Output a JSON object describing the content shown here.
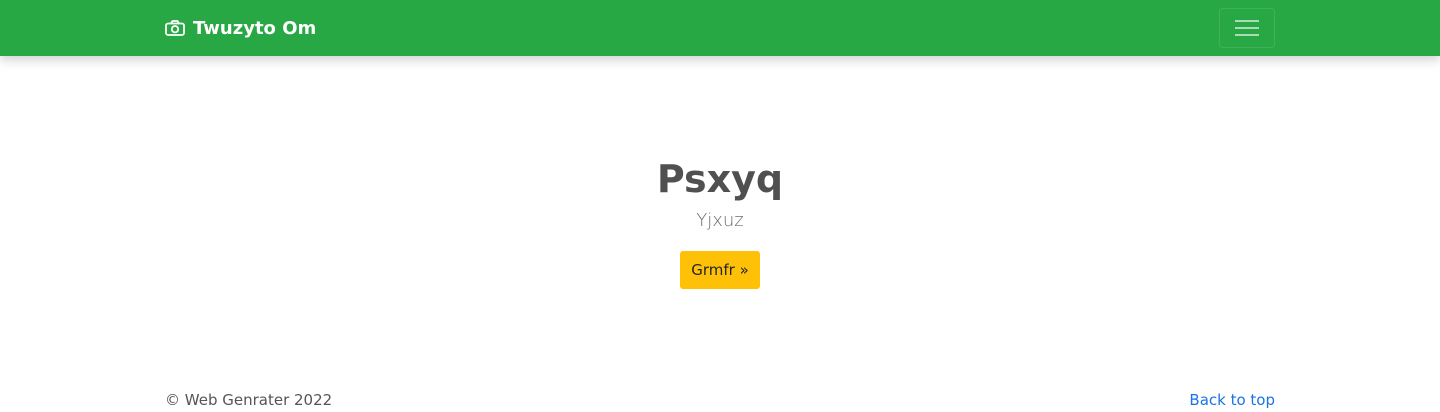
{
  "navbar": {
    "brand": {
      "icon": "camera-icon",
      "label": "Twuzyto Om"
    },
    "toggler": {
      "icon": "hamburger-menu-icon"
    },
    "color": "#28a745"
  },
  "hero": {
    "title": "Psxyq",
    "subtitle": "Yjxuz",
    "button_label": "Grmfr »",
    "button_color": "#ffc107"
  },
  "footer": {
    "copyright": "© Web Genrater 2022",
    "back_to_top": "Back to top",
    "link_color": "#1a73e8"
  }
}
